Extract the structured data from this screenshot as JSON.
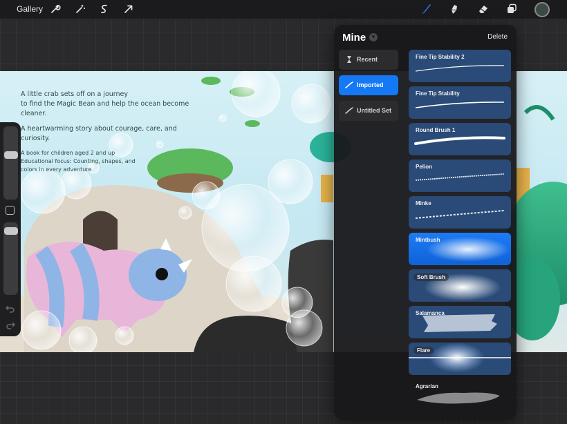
{
  "toolbar": {
    "gallery_label": "Gallery",
    "left_icons": [
      "wrench-icon",
      "magic-wand-icon",
      "selection-icon",
      "transform-arrow-icon"
    ],
    "right_icons": [
      "brush-icon",
      "smudge-icon",
      "eraser-icon",
      "layers-icon"
    ],
    "active_tool_color": "#2f7df6",
    "current_color": "#3b4a44"
  },
  "artwork": {
    "line1": "A little crab sets off on a journey",
    "line2": "to find the Magic Bean and help the ocean become cleaner.",
    "line3": "A heartwarming story about courage, care, and curiosity.",
    "line4": "A book for children aged 2 and up",
    "line5": "Educational focus: Counting, shapes, and",
    "line6": "colors in every adventure"
  },
  "sidebar": {
    "brush_size_level": 0.63,
    "brush_opacity_level": 0.95,
    "icons": [
      "modify-square-icon",
      "undo-icon",
      "redo-icon"
    ]
  },
  "brush_library": {
    "title": "Mine",
    "delete_label": "Delete",
    "sets": [
      {
        "label": "Recent",
        "icon": "hourglass-icon",
        "active": false
      },
      {
        "label": "Imported",
        "icon": "brush-stroke-icon",
        "active": true
      },
      {
        "label": "Untitled Set",
        "icon": "brush-stroke-icon",
        "active": false
      }
    ],
    "brushes": [
      {
        "name": "Fine Tip Stability 2",
        "active": false
      },
      {
        "name": "Fine Tip Stability",
        "active": false
      },
      {
        "name": "Round Brush 1",
        "active": false
      },
      {
        "name": "Pelion",
        "active": false
      },
      {
        "name": "Minke",
        "active": false
      },
      {
        "name": "Mintbush",
        "active": true
      },
      {
        "name": "Soft Brush",
        "active": false
      },
      {
        "name": "Salamanca",
        "active": false
      },
      {
        "name": "Flare",
        "active": false
      },
      {
        "name": "Agrarian",
        "active": false
      }
    ]
  },
  "colors": {
    "panel_background": "#18181b",
    "brush_tile": "#2a4a77",
    "selected": "#1578f5"
  }
}
